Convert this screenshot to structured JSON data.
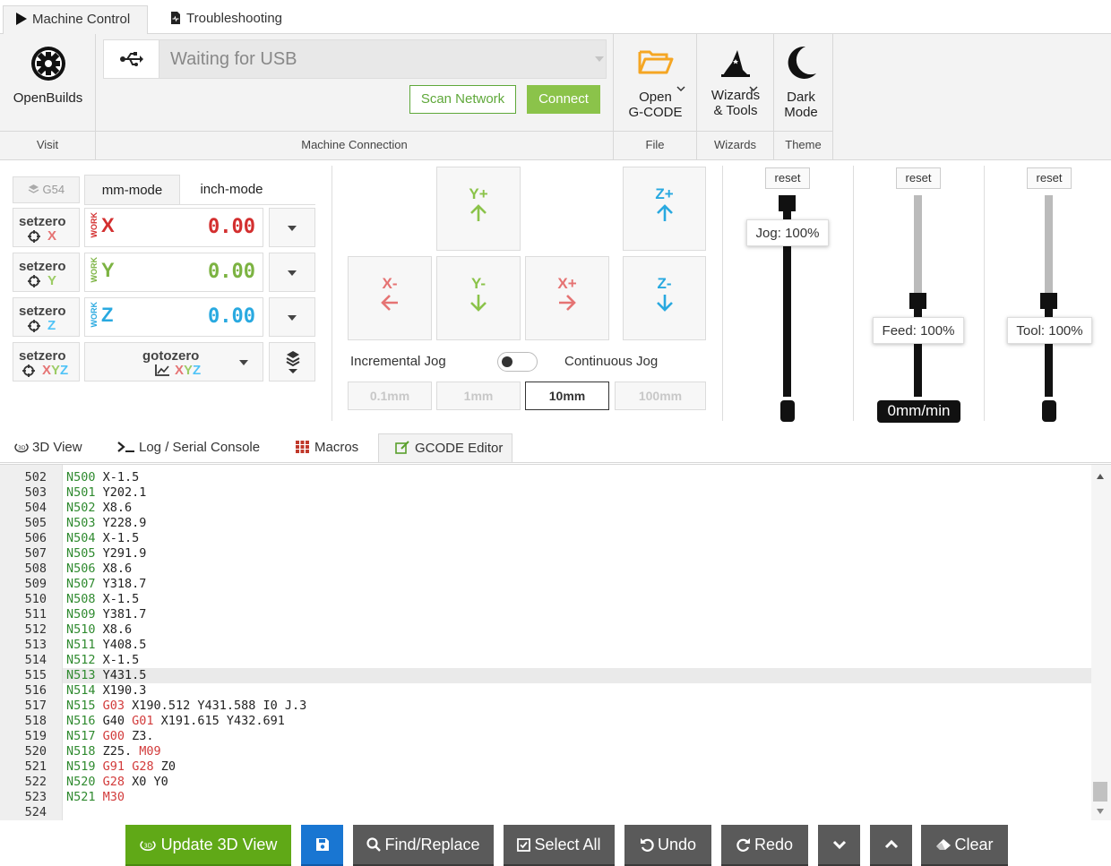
{
  "tabs": {
    "machine_control": "Machine Control",
    "troubleshooting": "Troubleshooting"
  },
  "ribbon": {
    "openbuilds_label": "OpenBuilds",
    "visit_label": "Visit",
    "port_status": "Waiting for USB",
    "scan_network": "Scan Network",
    "connect": "Connect",
    "machine_connection_label": "Machine Connection",
    "open_gcode_line1": "Open",
    "open_gcode_line2": "G-CODE",
    "file_label": "File",
    "wizards_line1": "Wizards",
    "wizards_line2": "& Tools",
    "wizards_label": "Wizards",
    "dark_line1": "Dark",
    "dark_line2": "Mode",
    "theme_label": "Theme"
  },
  "dro": {
    "wcs": "G54",
    "mm_mode": "mm-mode",
    "inch_mode": "inch-mode",
    "setzero": "setzero",
    "work": "WORK",
    "x_letter": "X",
    "y_letter": "Y",
    "z_letter": "Z",
    "xyz_letters": "XYZ",
    "x_value": "0.00",
    "y_value": "0.00",
    "z_value": "0.00",
    "gotozero": "gotozero"
  },
  "jog": {
    "y_plus": "Y+",
    "y_minus": "Y-",
    "x_plus": "X+",
    "x_minus": "X-",
    "z_plus": "Z+",
    "z_minus": "Z-",
    "incremental": "Incremental Jog",
    "continuous": "Continuous Jog",
    "steps": [
      "0.1mm",
      "1mm",
      "10mm",
      "100mm"
    ],
    "selected_step": "10mm"
  },
  "overrides": {
    "reset": "reset",
    "jog": "Jog: 100%",
    "feed": "Feed: 100%",
    "tool": "Tool: 100%",
    "feed_rate": "0mm/min",
    "jog_level": 1.0,
    "feed_level": 0.5,
    "tool_level": 0.5
  },
  "bottom_tabs": {
    "view3d": "3D View",
    "log": "Log / Serial Console",
    "macros": "Macros",
    "gcode_editor": "GCODE Editor"
  },
  "editor": {
    "active_line": 515,
    "lines": [
      {
        "n": "502",
        "parts": [
          [
            "N500",
            "N"
          ],
          [
            " X-1.5",
            ""
          ]
        ]
      },
      {
        "n": "503",
        "parts": [
          [
            "N501",
            "N"
          ],
          [
            " Y202.1",
            ""
          ]
        ]
      },
      {
        "n": "504",
        "parts": [
          [
            "N502",
            "N"
          ],
          [
            " X8.6",
            ""
          ]
        ]
      },
      {
        "n": "505",
        "parts": [
          [
            "N503",
            "N"
          ],
          [
            " Y228.9",
            ""
          ]
        ]
      },
      {
        "n": "506",
        "parts": [
          [
            "N504",
            "N"
          ],
          [
            " X-1.5",
            ""
          ]
        ]
      },
      {
        "n": "507",
        "parts": [
          [
            "N505",
            "N"
          ],
          [
            " Y291.9",
            ""
          ]
        ]
      },
      {
        "n": "508",
        "parts": [
          [
            "N506",
            "N"
          ],
          [
            " X8.6",
            ""
          ]
        ]
      },
      {
        "n": "509",
        "parts": [
          [
            "N507",
            "N"
          ],
          [
            " Y318.7",
            ""
          ]
        ]
      },
      {
        "n": "510",
        "parts": [
          [
            "N508",
            "N"
          ],
          [
            " X-1.5",
            ""
          ]
        ]
      },
      {
        "n": "511",
        "parts": [
          [
            "N509",
            "N"
          ],
          [
            " Y381.7",
            ""
          ]
        ]
      },
      {
        "n": "512",
        "parts": [
          [
            "N510",
            "N"
          ],
          [
            " X8.6",
            ""
          ]
        ]
      },
      {
        "n": "513",
        "parts": [
          [
            "N511",
            "N"
          ],
          [
            " Y408.5",
            ""
          ]
        ]
      },
      {
        "n": "514",
        "parts": [
          [
            "N512",
            "N"
          ],
          [
            " X-1.5",
            ""
          ]
        ]
      },
      {
        "n": "515",
        "parts": [
          [
            "N513",
            "N"
          ],
          [
            " Y431.5",
            ""
          ]
        ]
      },
      {
        "n": "516",
        "parts": [
          [
            "N514",
            "N"
          ],
          [
            " X190.3",
            ""
          ]
        ]
      },
      {
        "n": "517",
        "parts": [
          [
            "N515",
            "N"
          ],
          [
            " ",
            ""
          ],
          [
            "G03",
            "G"
          ],
          [
            " X190.512 Y431.588 I0 J.3",
            ""
          ]
        ]
      },
      {
        "n": "518",
        "parts": [
          [
            "N516",
            "N"
          ],
          [
            " G40 ",
            ""
          ],
          [
            "G01",
            "G"
          ],
          [
            " X191.615 Y432.691",
            ""
          ]
        ]
      },
      {
        "n": "519",
        "parts": [
          [
            "N517",
            "N"
          ],
          [
            " ",
            ""
          ],
          [
            "G00",
            "G"
          ],
          [
            " Z3.",
            ""
          ]
        ]
      },
      {
        "n": "520",
        "parts": [
          [
            "N518",
            "N"
          ],
          [
            " Z25. ",
            ""
          ],
          [
            "M09",
            "G"
          ]
        ]
      },
      {
        "n": "521",
        "parts": [
          [
            "N519",
            "N"
          ],
          [
            " ",
            ""
          ],
          [
            "G91",
            "G"
          ],
          [
            " ",
            ""
          ],
          [
            "G28",
            "G"
          ],
          [
            " Z0",
            ""
          ]
        ]
      },
      {
        "n": "522",
        "parts": [
          [
            "N520",
            "N"
          ],
          [
            " ",
            ""
          ],
          [
            "G28",
            "G"
          ],
          [
            " X0 Y0",
            ""
          ]
        ]
      },
      {
        "n": "523",
        "parts": [
          [
            "N521",
            "N"
          ],
          [
            " ",
            ""
          ],
          [
            "M30",
            "G"
          ]
        ]
      },
      {
        "n": "524",
        "parts": []
      }
    ]
  },
  "toolbar": {
    "update_3d": "Update 3D View",
    "find_replace": "Find/Replace",
    "select_all": "Select All",
    "undo": "Undo",
    "redo": "Redo",
    "clear": "Clear"
  },
  "colors": {
    "x_axis": "#d32f2f",
    "y_axis": "#7cb342",
    "z_axis": "#29a9e0",
    "green": "#8bc34a",
    "blue_save": "#1976d2"
  }
}
